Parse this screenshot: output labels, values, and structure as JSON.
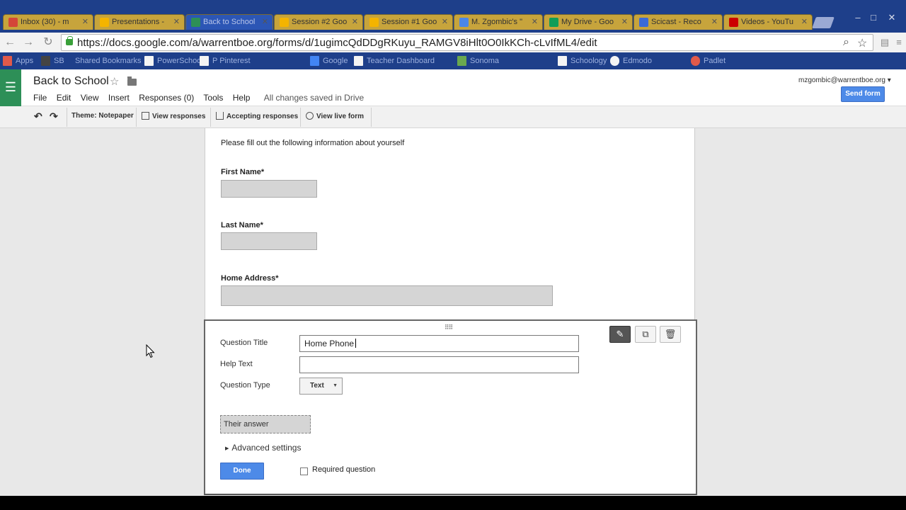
{
  "browser": {
    "tabs": [
      {
        "label": "Inbox (30) - m",
        "icon_color": "#d44638"
      },
      {
        "label": "Presentations -",
        "icon_color": "#f4b400"
      },
      {
        "label": "Back to School",
        "icon_color": "#2d8f57"
      },
      {
        "label": "Session #2 Goo",
        "icon_color": "#f4b400"
      },
      {
        "label": "Session #1 Goo",
        "icon_color": "#f4b400"
      },
      {
        "label": "M. Zgombic's \"",
        "icon_color": "#4a86e8"
      },
      {
        "label": "My Drive - Goo",
        "icon_color": "#0f9d58"
      },
      {
        "label": "Scicast - Reco",
        "icon_color": "#3a6ad8"
      },
      {
        "label": "Videos - YouTu",
        "icon_color": "#cc0000"
      }
    ],
    "url": "https://docs.google.com/a/warrentboe.org/forms/d/1ugimcQdDDgRKuyu_RAMGV8iHlt0O0IkKCh-cLvIfML4/edit",
    "bookmarks": [
      {
        "label": "Apps"
      },
      {
        "label": "SB"
      },
      {
        "label": "Shared Bookmarks"
      },
      {
        "label": "PowerSchool"
      },
      {
        "label": "P Pinterest"
      },
      {
        "label": "Google"
      },
      {
        "label": "Teacher Dashboard"
      },
      {
        "label": "Sonoma"
      },
      {
        "label": "Schoology"
      },
      {
        "label": "Edmodo"
      },
      {
        "label": "Padlet"
      }
    ]
  },
  "app": {
    "title": "Back to School",
    "menu": [
      "File",
      "Edit",
      "View",
      "Insert",
      "Responses (0)",
      "Tools",
      "Help"
    ],
    "saved_status": "All changes saved in Drive",
    "account": "mzgombic@warrentboe.org",
    "send_form_label": "Send form"
  },
  "form_toolbar": {
    "theme_label": "Theme: Notepaper",
    "view_responses_label": "View responses",
    "accepting_responses_label": "Accepting responses",
    "view_live_form_label": "View live form"
  },
  "form": {
    "intro": "Please fill out the following information about yourself",
    "questions": [
      {
        "label": "First Name*"
      },
      {
        "label": "Last Name*"
      },
      {
        "label": "Home Address*"
      }
    ]
  },
  "editor": {
    "question_title_label": "Question Title",
    "question_title_value": "Home Phone",
    "help_text_label": "Help Text",
    "help_text_value": "",
    "question_type_label": "Question Type",
    "question_type_value": "Text",
    "preview_placeholder": "Their answer",
    "advanced_settings_label": "Advanced settings",
    "done_label": "Done",
    "required_label": "Required question",
    "required_checked": false
  }
}
